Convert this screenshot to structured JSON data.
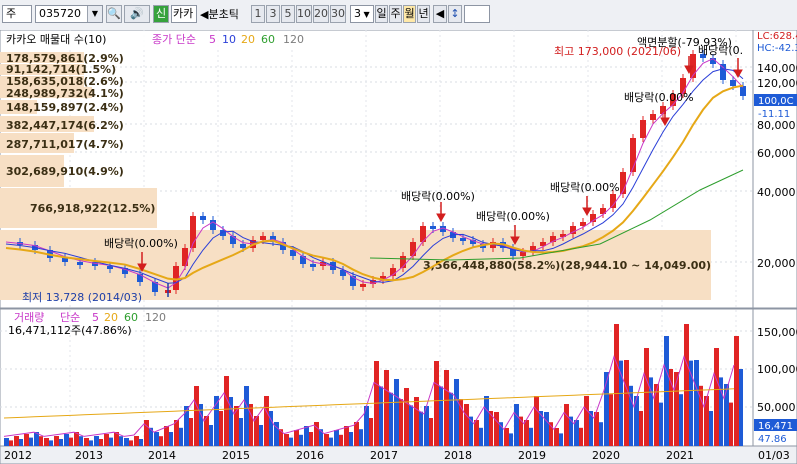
{
  "toolbar": {
    "market": "주",
    "code": "035720",
    "company_label": "카카",
    "tab_green": "신",
    "period_label": "분초틱",
    "periods": [
      "1",
      "3",
      "5",
      "10",
      "20",
      "30"
    ],
    "count": "3",
    "tf_day": "일",
    "tf_week": "주",
    "tf_month": "월",
    "tf_year": "년"
  },
  "price_panel": {
    "title": "카카오 매물대 수(10)",
    "ma_label": "종가 단순",
    "ma_periods": [
      "5",
      "10",
      "20",
      "60",
      "120"
    ],
    "lc_label": "LC:628.4",
    "hc_label": "HC:-42.3",
    "current_price_tag": "100,0C",
    "current_change_tag": "-11.11",
    "y_ticks": [
      "140,000",
      "120,000",
      "100,000",
      "80,000",
      "60,000",
      "40,000",
      "20,000"
    ],
    "volume_profile_labels": [
      "178,579,861(2.9%)",
      "91,142,714(1.5%)",
      "158,635,018(2.6%)",
      "248,989,732(4.1%)",
      "148,159,897(2.4%)",
      "382,447,174(6.2%)",
      "287,711,017(4.7%)",
      "302,689,910(4.9%)",
      "766,918,922(12.5%)",
      "3,566,448,880(58.2%)(28,944.10 ~ 14,049.00)"
    ],
    "annotations": {
      "high": "최고 173,000 (2021/06)",
      "low": "최저 13,728 (2014/03)",
      "dividend": "배당락(0.00%)",
      "dividend_trunc1": "배당락(0.00%",
      "dividend_trunc2": "배당락(0.",
      "rights": "액면분할(-79.93%)"
    }
  },
  "volume_panel": {
    "title": "거래량",
    "ma_label": "단순",
    "ma_periods": [
      "5",
      "20",
      "60",
      "120"
    ],
    "value_label": "16,471,112주(47.86%)",
    "y_ticks": [
      "150,000",
      "100,000",
      "50,000"
    ],
    "current_tag": "16,471",
    "current_pct": "47.86"
  },
  "x_axis": [
    "2012",
    "2013",
    "2014",
    "2015",
    "2016",
    "2017",
    "2018",
    "2019",
    "2020",
    "2021",
    "01/03"
  ],
  "colors": {
    "up": "#e02424",
    "down": "#1e5bd6",
    "ma5": "#c838c8",
    "ma10": "#2b3fd8",
    "ma20": "#e6a817",
    "ma60": "#2e9e2e",
    "ma120": "#7d7d7d",
    "volume_profile": "#f7dfc4"
  }
}
